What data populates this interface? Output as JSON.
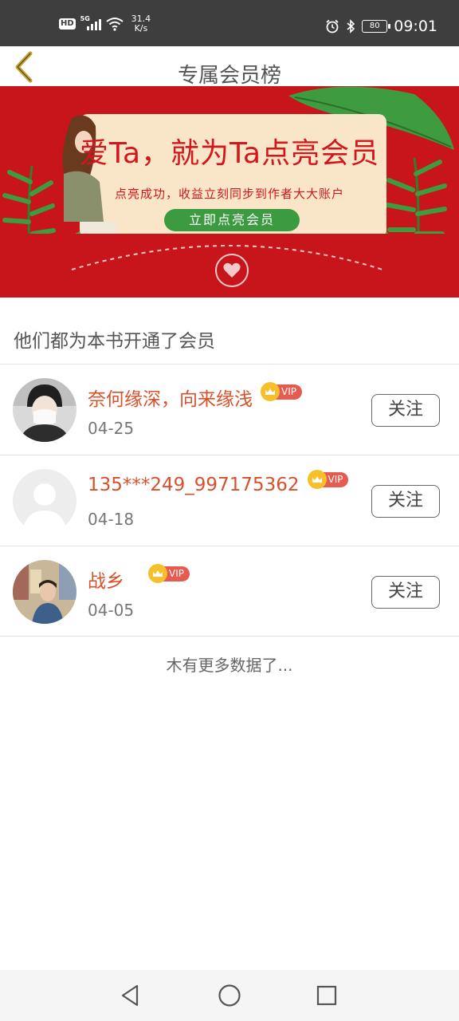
{
  "status_bar": {
    "hd_badge": "HD",
    "network": "5G",
    "net_speed_value": "31.4",
    "net_speed_unit": "K/s",
    "battery": "80",
    "time": "09:01"
  },
  "header": {
    "title": "专属会员榜",
    "back_icon": "chevron-left-icon",
    "accent": "#c9a227"
  },
  "banner": {
    "headline": "爱Ta，就为Ta点亮会员",
    "subtext": "点亮成功，收益立刻同步到作者大大账户",
    "cta_label": "立即点亮会员",
    "bg_color": "#c8151b",
    "cta_color": "#3c9b41"
  },
  "section": {
    "heading": "他们都为本书开通了会员"
  },
  "members": [
    {
      "name": "奈何缘深，向来缘浅",
      "badge": "VIP",
      "date": "04-25",
      "follow_label": "关注",
      "avatar": "avatar-photo"
    },
    {
      "name": "135***249_997175362",
      "badge": "VIP",
      "date": "04-18",
      "follow_label": "关注",
      "avatar": "avatar-placeholder"
    },
    {
      "name": "战乡",
      "badge": "VIP",
      "date": "04-05",
      "follow_label": "关注",
      "avatar": "avatar-photo"
    }
  ],
  "footer_text": "木有更多数据了...",
  "nav": {
    "back_icon": "triangle-back-icon",
    "home_icon": "circle-home-icon",
    "recents_icon": "square-recents-icon"
  },
  "colors": {
    "name_color": "#d9502a",
    "vip_badge": "#e65a4f",
    "crown": "#f7c02b"
  }
}
